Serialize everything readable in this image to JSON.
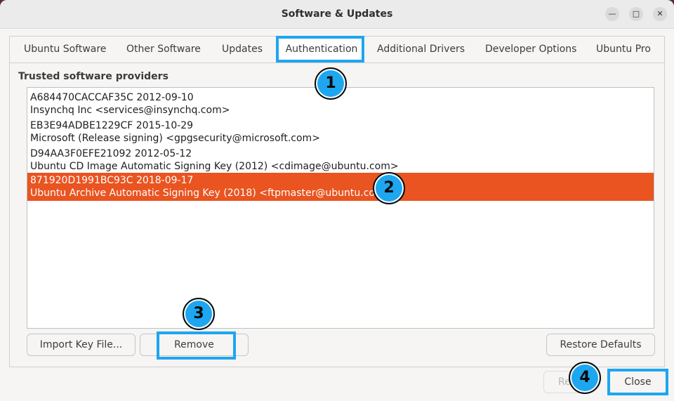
{
  "window": {
    "title": "Software & Updates"
  },
  "tabs": [
    {
      "label": "Ubuntu Software"
    },
    {
      "label": "Other Software"
    },
    {
      "label": "Updates"
    },
    {
      "label": "Authentication"
    },
    {
      "label": "Additional Drivers"
    },
    {
      "label": "Developer Options"
    },
    {
      "label": "Ubuntu Pro"
    }
  ],
  "section_title": "Trusted software providers",
  "keys": [
    {
      "line1": "A684470CACCAF35C 2012-09-10",
      "line2": "Insynchq Inc <services@insynchq.com>"
    },
    {
      "line1": "EB3E94ADBE1229CF 2015-10-29",
      "line2": "Microsoft (Release signing) <gpgsecurity@microsoft.com>"
    },
    {
      "line1": "D94AA3F0EFE21092 2012-05-12",
      "line2": "Ubuntu CD Image Automatic Signing Key (2012) <cdimage@ubuntu.com>"
    },
    {
      "line1": "871920D1991BC93C 2018-09-17",
      "line2": "Ubuntu Archive Automatic Signing Key (2018) <ftpmaster@ubuntu.com>"
    }
  ],
  "buttons": {
    "import": "Import Key File...",
    "remove": "Remove",
    "restore": "Restore Defaults",
    "revert": "Re",
    "close": "Close"
  },
  "badges": [
    "1",
    "2",
    "3",
    "4"
  ],
  "colors": {
    "accent": "#e95420",
    "callout": "#1ea6f0"
  }
}
